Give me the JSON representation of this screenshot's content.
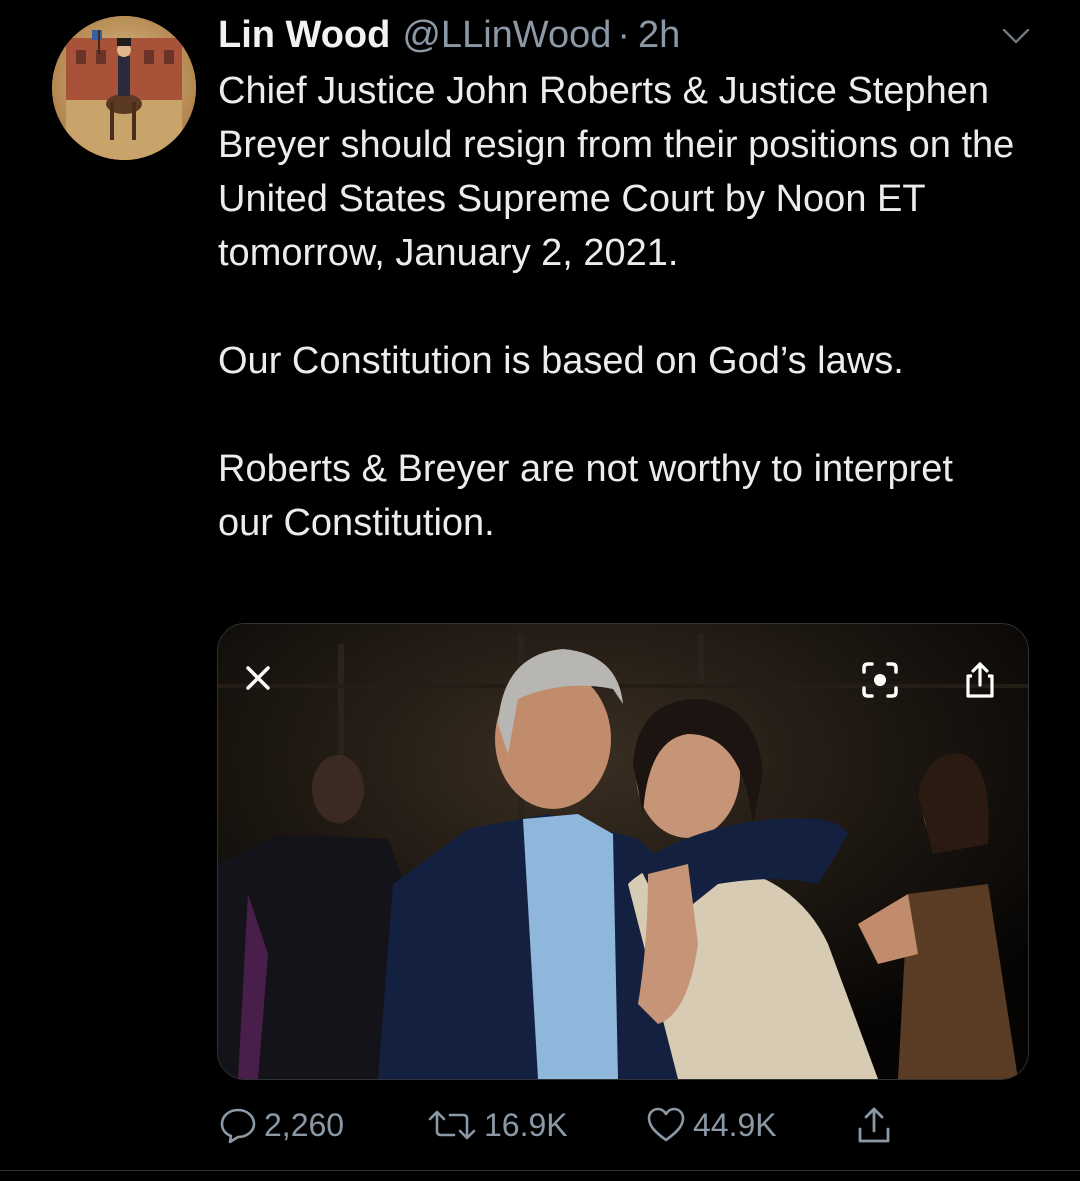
{
  "author": {
    "display_name": "Lin Wood",
    "handle": "@LLinWood",
    "separator": "·",
    "time_ago": "2h"
  },
  "tweet": {
    "paragraphs": [
      "Chief Justice John Roberts & Justice Stephen Breyer should resign from their positions on the United States Supreme Court by Noon ET tomorrow, January 2, 2021.",
      "Our Constitution is based on God’s laws.",
      "Roberts & Breyer are not worthy to interpret our Constitution."
    ]
  },
  "media": {
    "icons": [
      "close-icon",
      "lens-icon",
      "share-icon"
    ]
  },
  "actions": {
    "replies": "2,260",
    "retweets": "16.9K",
    "likes": "44.9K"
  },
  "icons": {
    "more": "chevron-down-icon",
    "reply": "speech-bubble-icon",
    "retweet": "retweet-arrows-icon",
    "like": "heart-icon",
    "share": "share-upload-icon"
  },
  "colors": {
    "background": "#000000",
    "text": "#e7e9ea",
    "muted": "#8b98a5"
  }
}
